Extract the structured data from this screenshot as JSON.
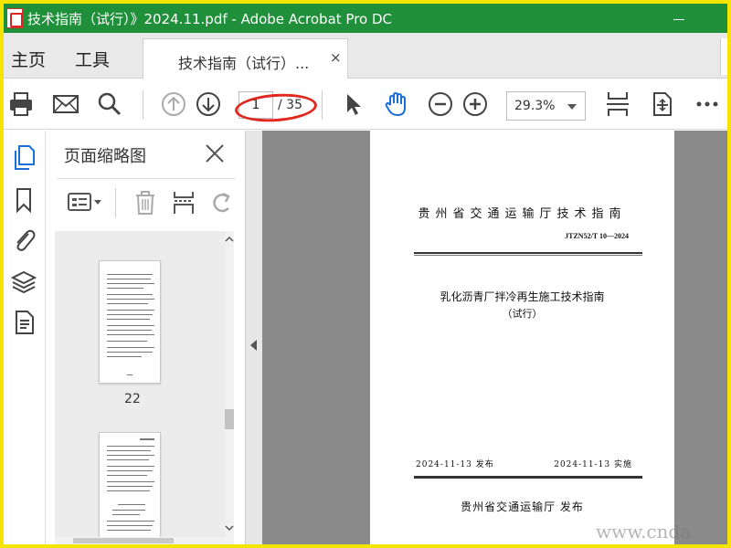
{
  "window": {
    "title": "技术指南（试行）》2024.11.pdf - Adobe Acrobat Pro DC"
  },
  "menu": {
    "home": "主页",
    "tools": "工具"
  },
  "tab": {
    "label": "技术指南（试行）...",
    "close": "×"
  },
  "toolbar": {
    "page_current": "1",
    "page_total": "/ 35",
    "zoom": "29.3%"
  },
  "panel": {
    "title": "页面缩略图",
    "thumb_label": "22"
  },
  "document": {
    "header": "贵州省交通运输厅技术指南",
    "code": "JTZN52/T 10—2024",
    "title": "乳化沥青厂拌冷再生施工技术指南",
    "subtitle": "（试行）",
    "issue_date": "2024-11-13  发布",
    "effect_date": "2024-11-13  实施",
    "publisher": "贵州省交通运输厅  发布"
  },
  "watermark": "www.cnda",
  "colors": {
    "titlebar": "#1f8f3a",
    "frame": "#f5e400",
    "annotation": "#e0281e",
    "hand_tool": "#1a6fd6"
  }
}
